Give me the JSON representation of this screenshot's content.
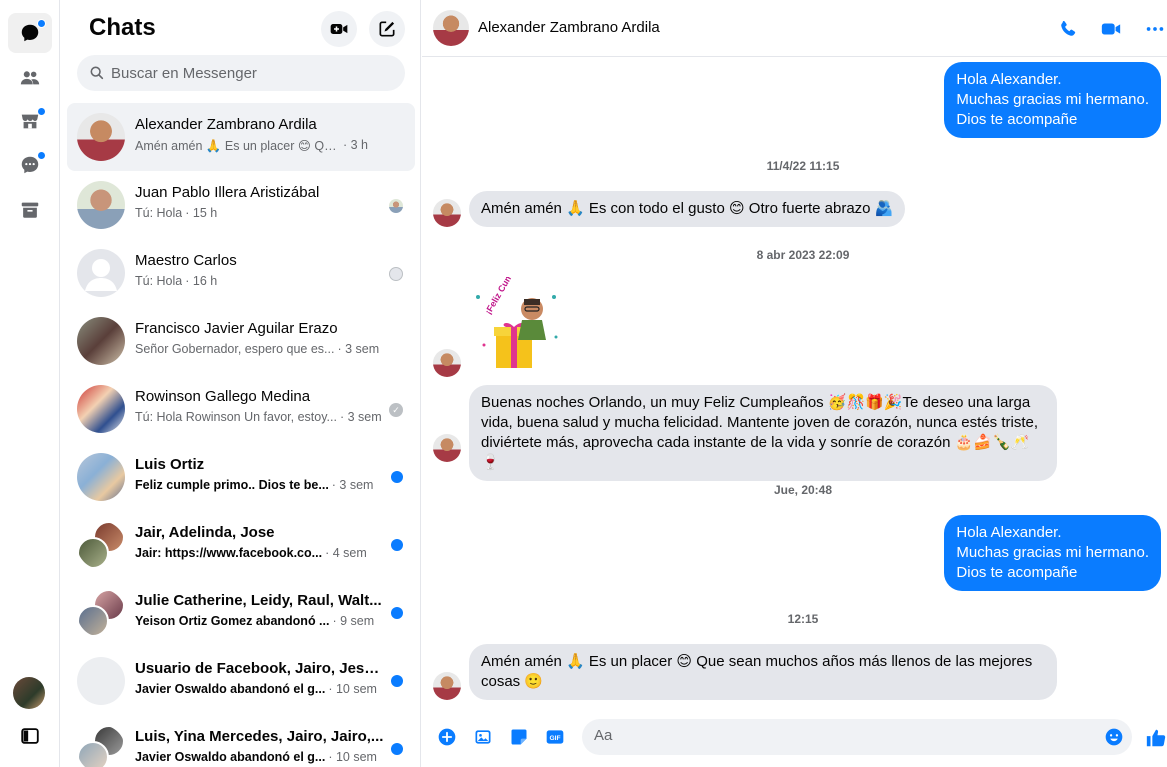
{
  "colors": {
    "accent": "#0a7cff",
    "bubble_in": "#e4e6eb",
    "muted": "#65676b"
  },
  "rail": {
    "items": [
      {
        "icon": "chat-bubble-icon",
        "active": true,
        "badge": true
      },
      {
        "icon": "people-icon",
        "active": false,
        "badge": false
      },
      {
        "icon": "marketplace-icon",
        "active": false,
        "badge": true
      },
      {
        "icon": "message-requests-icon",
        "active": false,
        "badge": true
      },
      {
        "icon": "archive-icon",
        "active": false,
        "badge": false
      }
    ]
  },
  "sidebar": {
    "title": "Chats",
    "search_placeholder": "Buscar en Messenger",
    "chats": [
      {
        "name": "Alexander Zambrano Ardila",
        "preview": "Amén amén 🙏 Es un placer 😊 Qu...",
        "time": "· 3 h",
        "unread": false,
        "selected": true,
        "status": "none"
      },
      {
        "name": "Juan Pablo Illera Aristizábal",
        "preview": "Tú: Hola",
        "time": "· 15 h",
        "unread": false,
        "selected": false,
        "status": "seen-avatar"
      },
      {
        "name": "Maestro Carlos",
        "preview": "Tú: Hola",
        "time": "· 16 h",
        "unread": false,
        "selected": false,
        "status": "seen-avatar"
      },
      {
        "name": "Francisco Javier Aguilar Erazo",
        "preview": "Señor Gobernador, espero que es...",
        "time": "· 3 sem",
        "unread": false,
        "selected": false,
        "status": "none"
      },
      {
        "name": "Rowinson Gallego Medina",
        "preview": "Tú: Hola Rowinson Un favor, estoy...",
        "time": "· 3 sem",
        "unread": false,
        "selected": false,
        "status": "delivered"
      },
      {
        "name": "Luis Ortiz",
        "preview": "Feliz cumple primo.. Dios te be...",
        "time": "· 3 sem",
        "unread": true,
        "selected": false,
        "status": "unread"
      },
      {
        "name": "Jair, Adelinda, Jose",
        "preview": "Jair: https://www.facebook.co...",
        "time": "· 4 sem",
        "unread": true,
        "selected": false,
        "status": "unread"
      },
      {
        "name": "Julie Catherine, Leidy, Raul, Walt...",
        "preview": "Yeison Ortiz Gomez abandonó ...",
        "time": "· 9 sem",
        "unread": true,
        "selected": false,
        "status": "unread"
      },
      {
        "name": "Usuario de Facebook, Jairo, Jesu...",
        "preview": "Javier Oswaldo abandonó el g...",
        "time": "· 10 sem",
        "unread": true,
        "selected": false,
        "status": "unread"
      },
      {
        "name": "Luis, Yina Mercedes, Jairo, Jairo,...",
        "preview": "Javier Oswaldo abandonó el g...",
        "time": "· 10 sem",
        "unread": true,
        "selected": false,
        "status": "unread"
      }
    ]
  },
  "conversation": {
    "name": "Alexander Zambrano Ardila",
    "messages": {
      "out1": [
        "Hola Alexander.",
        "Muchas gracias mi hermano.",
        "Dios te acompañe"
      ],
      "ts1": "11/4/22 11:15",
      "in1": "Amén amén 🙏 Es con todo el gusto 😊 Otro fuerte abrazo 🫂",
      "ts2": "8 abr 2023 22:09",
      "sticker_text": "¡Feliz Cumple!",
      "in2": "Buenas noches  Orlando, un muy Feliz Cumpleaños 🥳🎊🎁🎉Te deseo una larga vida, buena salud y mucha felicidad. Mantente joven de corazón, nunca estés triste, diviértete más, aprovecha cada instante de la vida y sonríe de corazón 🎂🍰🍾🥂🍷",
      "ts3": "Jue, 20:48",
      "out2": [
        "Hola Alexander.",
        "Muchas gracias mi hermano.",
        "Dios te acompañe"
      ],
      "ts4": "12:15",
      "in3": "Amén amén 🙏 Es un placer 😊 Que sean muchos años más llenos de las mejores cosas 🙂"
    }
  },
  "composer": {
    "placeholder": "Aa",
    "icons": [
      "plus-circle-icon",
      "photo-icon",
      "sticker-icon",
      "gif-icon",
      "emoji-icon",
      "like-icon"
    ]
  }
}
